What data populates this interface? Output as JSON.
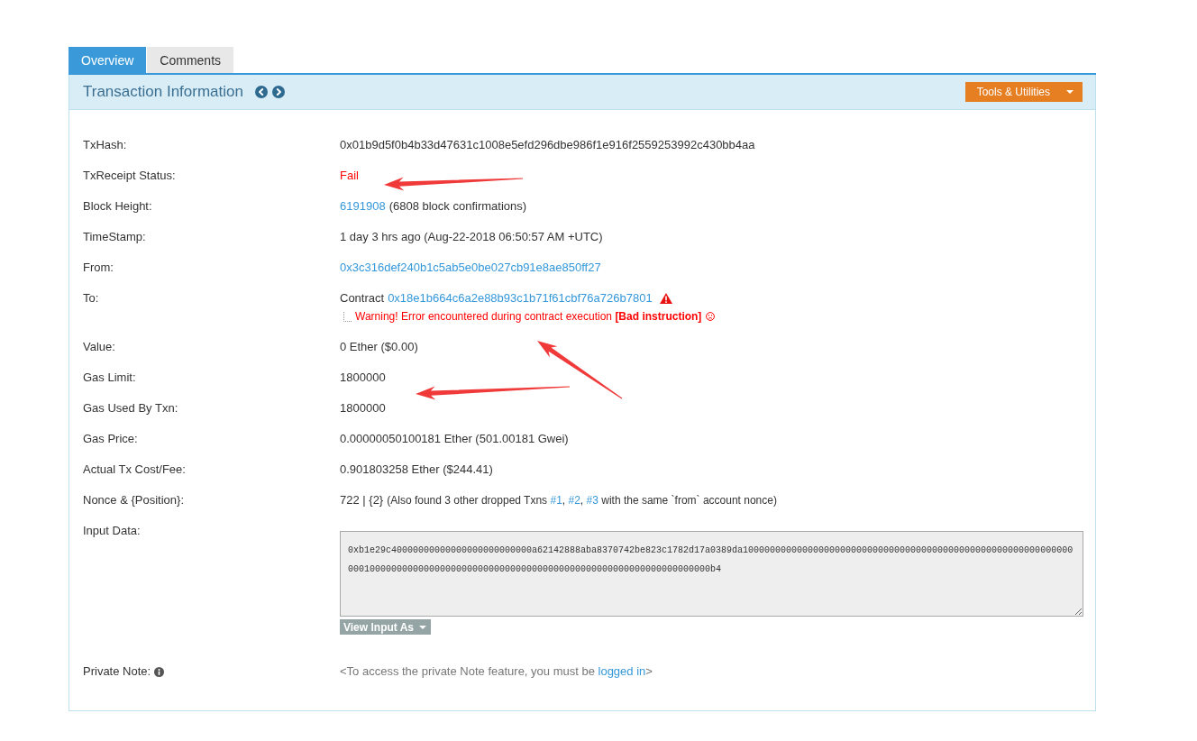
{
  "tabs": [
    {
      "label": "Overview",
      "selected": true
    },
    {
      "label": "Comments",
      "selected": false
    }
  ],
  "panel": {
    "title": "Transaction Information",
    "tools_button": "Tools & Utilities"
  },
  "fields": [
    {
      "kind": "text",
      "label": "TxHash:",
      "value": "0x01b9d5f0b4b33d47631c1008e5efd296dbe986f1e916f2559253992c430bb4aa"
    },
    {
      "kind": "status",
      "label": "TxReceipt Status:",
      "value": "Fail",
      "failed": true
    },
    {
      "kind": "block",
      "label": "Block Height:",
      "link": "6191908",
      "value": "(6808 block confirmations)"
    },
    {
      "kind": "text",
      "label": "TimeStamp:",
      "value": "1 day 3 hrs ago (Aug-22-2018 06:50:57 AM +UTC)"
    },
    {
      "kind": "link",
      "label": "From:",
      "value": "0x3c316def240b1c5ab5e0be027cb91e8ae850ff27"
    },
    {
      "kind": "contract",
      "label": "To:",
      "value": "Contract",
      "link": "0x18e1b664c6a2e88b93c1b71f61cbf76a726b7801",
      "warning": "Warning! Error encountered during contract execution **[Bad instruction]**"
    },
    {
      "kind": "text",
      "label": "Value:",
      "value": "0 Ether ($0.00)"
    },
    {
      "kind": "text",
      "label": "Gas Limit:",
      "value": "1800000"
    },
    {
      "kind": "text",
      "label": "Gas Used By Txn:",
      "value": "1800000"
    },
    {
      "kind": "text",
      "label": "Gas Price:",
      "value": "0.00000050100181 Ether (501.00181 Gwei)"
    },
    {
      "kind": "text",
      "label": "Actual Tx Cost/Fee:",
      "value": "0.901803258 Ether ($244.41)"
    },
    {
      "kind": "nonce",
      "label": "Nonce & {Position}:",
      "value": "722 | {2}",
      "note": [
        {
          "kind": "text",
          "text": "(Also found 3 other dropped Txns "
        },
        {
          "kind": "link",
          "text": "#1"
        },
        {
          "kind": "text",
          "text": ", "
        },
        {
          "kind": "link",
          "text": "#2"
        },
        {
          "kind": "text",
          "text": ", "
        },
        {
          "kind": "link",
          "text": "#3"
        },
        {
          "kind": "text",
          "text": " with the same `from` account nonce)"
        }
      ]
    },
    {
      "kind": "input",
      "label": "Input Data:",
      "value": "0xb1e29c40000000000000000000000000a62142888aba8370742be823c1782d17a0389da10000000000000000000000000000000000000000000000000000000000000001000000000000000000000000000000000000000000000000000000000000000b4",
      "button": "View Input As"
    },
    {
      "kind": "note",
      "label": "Private Note:",
      "note": [
        {
          "kind": "text",
          "text": "<To access the private Note feature, you must be "
        },
        {
          "kind": "link",
          "text": "logged in"
        },
        {
          "kind": "text",
          "text": ">"
        }
      ]
    }
  ]
}
